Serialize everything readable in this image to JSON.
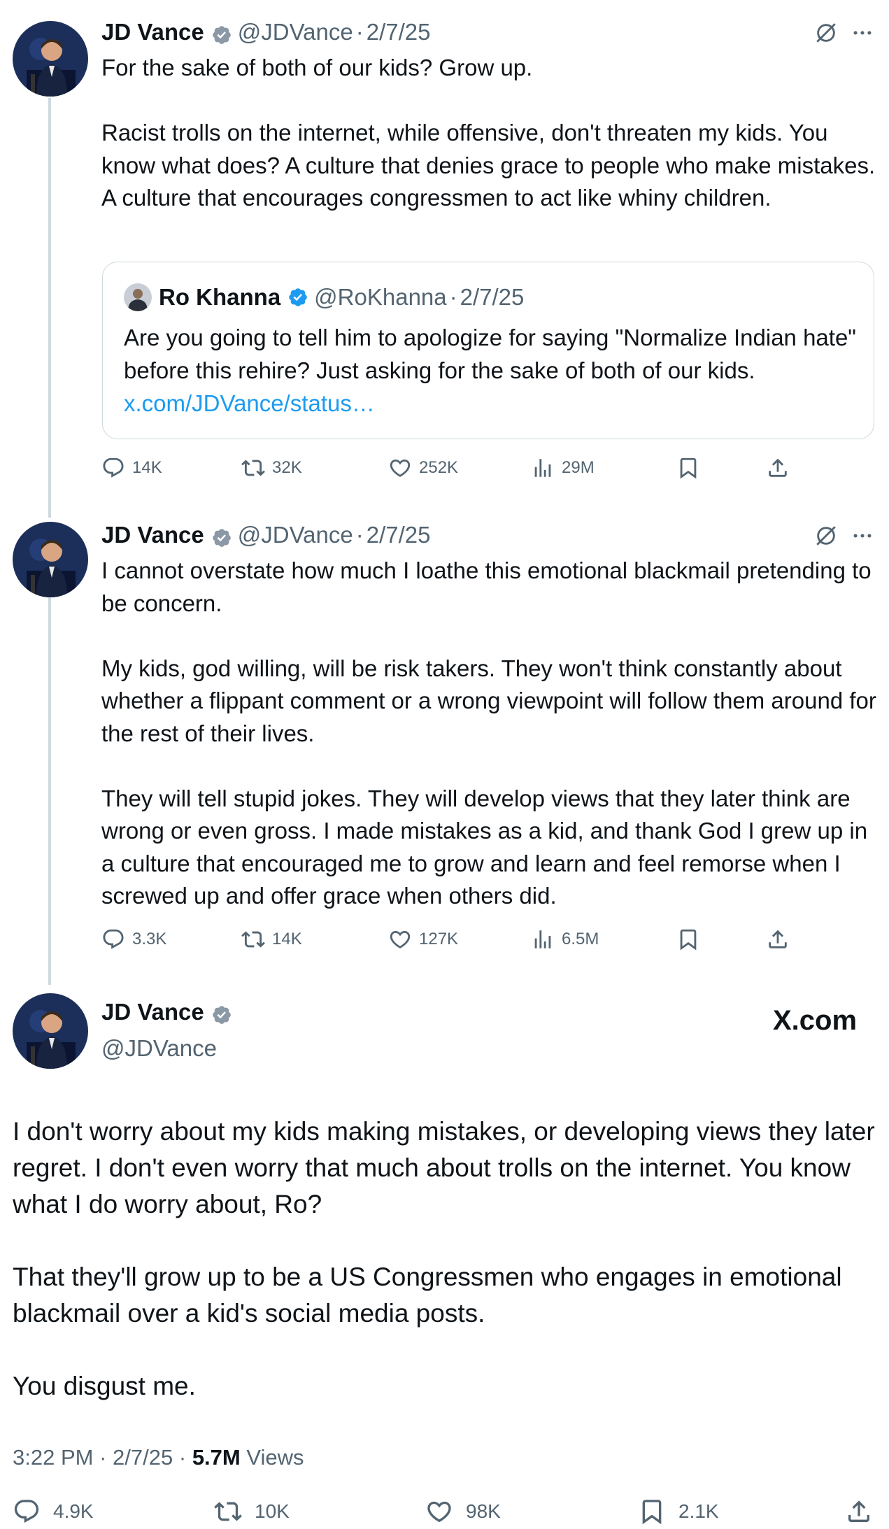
{
  "tweet1": {
    "author_name": "JD Vance",
    "author_handle": "@JDVance",
    "separator": "·",
    "date": "2/7/25",
    "paragraphs": [
      "For the sake of both of our kids? Grow up.",
      "Racist trolls on the internet, while offensive, don't threaten my kids. You know what does? A culture that denies grace to people who make mistakes. A culture that encourages congressmen to act like whiny children."
    ],
    "quote": {
      "author_name": "Ro Khanna",
      "author_handle": "@RoKhanna",
      "separator": "·",
      "date": "2/7/25",
      "text": "Are you going to tell him to apologize for saying \"Normalize Indian hate\" before this rehire? Just asking for the sake of both of our kids.",
      "link": "x.com/JDVance/status…"
    },
    "stats": {
      "replies": "14K",
      "reposts": "32K",
      "likes": "252K",
      "views": "29M"
    }
  },
  "tweet2": {
    "author_name": "JD Vance",
    "author_handle": "@JDVance",
    "separator": "·",
    "date": "2/7/25",
    "paragraphs": [
      "I cannot overstate how much I loathe this emotional blackmail pretending to be concern.",
      "My kids, god willing, will be risk takers. They won't think constantly about whether a flippant comment or a wrong viewpoint will follow them around for the rest of their lives.",
      "They will tell stupid jokes. They will develop views that they later think are wrong or even gross. I made mistakes as a kid, and thank God I grew up in a culture that encouraged me to grow and learn and feel remorse when I screwed up and offer grace when others did."
    ],
    "stats": {
      "replies": "3.3K",
      "reposts": "14K",
      "likes": "127K",
      "views": "6.5M"
    }
  },
  "main_tweet": {
    "author_name": "JD Vance",
    "author_handle": "@JDVance",
    "site_logo": "X.com",
    "paragraphs": [
      "I don't worry about my kids making mistakes, or developing views they later regret. I don't even worry that much about trolls on the internet. You know what I do worry about, Ro?",
      "That they'll grow up to be a US Congressmen who engages in emotional blackmail over a kid's social media posts.",
      "You disgust me."
    ],
    "time": "3:22 PM",
    "separator": "·",
    "date": "2/7/25",
    "views_count": "5.7M",
    "views_label": "Views",
    "stats": {
      "replies": "4.9K",
      "reposts": "10K",
      "likes": "98K",
      "bookmarks": "2.1K"
    }
  },
  "colors": {
    "text_primary": "#0f1419",
    "text_secondary": "#536471",
    "verified_gold": "#8b98a5",
    "verified_blue": "#1d9bf0",
    "link": "#1d9bf0",
    "thread_line": "#cfd9de"
  },
  "icons": [
    "reply-icon",
    "repost-icon",
    "like-icon",
    "views-icon",
    "bookmark-icon",
    "share-icon",
    "grok-icon",
    "more-icon",
    "verified-badge-icon",
    "x-logo"
  ]
}
